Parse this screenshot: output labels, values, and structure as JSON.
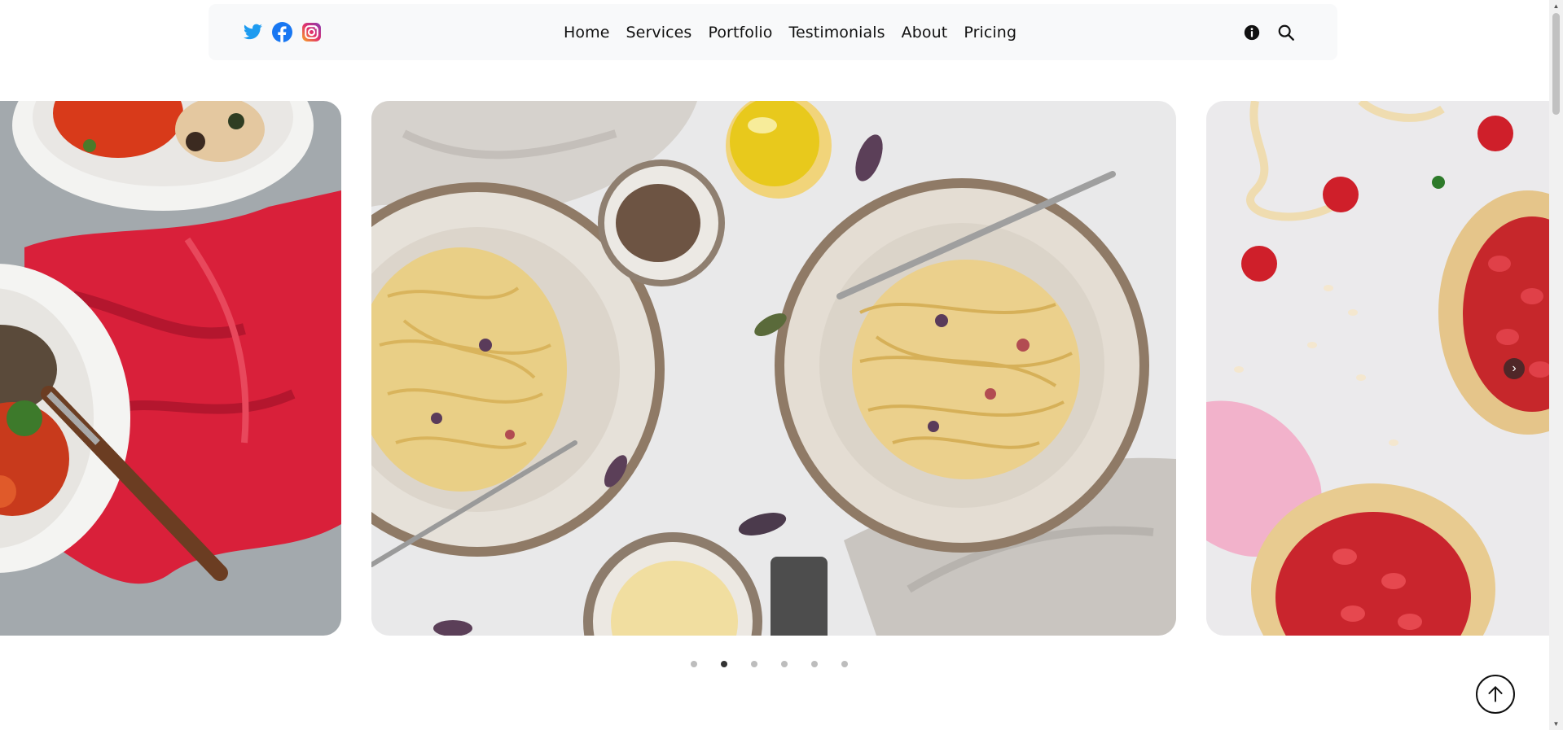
{
  "social": [
    {
      "name": "twitter-icon",
      "color": "#1d9bf0"
    },
    {
      "name": "facebook-icon",
      "color": "#1877f2"
    },
    {
      "name": "instagram-icon",
      "color": "#e1306c"
    }
  ],
  "nav": {
    "items": [
      {
        "label": "Home"
      },
      {
        "label": "Services"
      },
      {
        "label": "Portfolio"
      },
      {
        "label": "Testimonials"
      },
      {
        "label": "About"
      },
      {
        "label": "Pricing"
      }
    ]
  },
  "tools": [
    "info-icon",
    "search-icon"
  ],
  "carousel": {
    "slides": [
      {
        "name": "slide-roasted-vegetables-bowls"
      },
      {
        "name": "slide-pasta-carbonara-plates"
      },
      {
        "name": "slide-strawberry-galette"
      }
    ],
    "dot_count": 6,
    "active_index": 1
  },
  "icons": {
    "back_to_top": "arrow-up-icon",
    "next": "chevron-right-icon"
  }
}
